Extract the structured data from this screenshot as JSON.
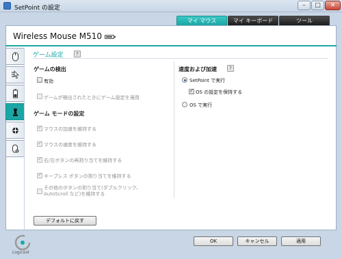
{
  "window": {
    "title": "SetPoint の設定"
  },
  "top_tabs": [
    "マイ マウス",
    "マイ キーボード",
    "ツール"
  ],
  "device": {
    "name": "Wireless Mouse M510",
    "battery_icon": "battery-icon"
  },
  "side_tabs": [
    {
      "icon": "mouse-icon"
    },
    {
      "icon": "pointer-icon"
    },
    {
      "icon": "battery-status-icon"
    },
    {
      "icon": "chess-piece-icon"
    },
    {
      "icon": "settings-icon"
    },
    {
      "icon": "mouse-gear-icon"
    }
  ],
  "section": {
    "title": "ゲーム設定",
    "help": "?"
  },
  "game_detect": {
    "title": "ゲームの検出",
    "enable": {
      "label": "有効",
      "checked": false
    },
    "apply": {
      "label": "ゲームが検出されたときにゲーム設定を適用",
      "checked": false
    }
  },
  "game_mode": {
    "title": "ゲーム モードの設定",
    "items": [
      "マウスの加速を維持する",
      "マウスの速度を維持する",
      "右/左ボタンの再割り当てを維持する",
      "キープレス ボタンの割り当てを維持する",
      "その他のボタンの割り当て(ダブルクリック、AutoScroll など)を維持する"
    ]
  },
  "speed": {
    "title": "速度および加速",
    "help": "?",
    "setpoint_run": "SetPoint で実行",
    "keep_os": "OS の設定を保持する",
    "os_run": "OS で実行"
  },
  "buttons": {
    "defaults": "デフォルトに戻す",
    "ok": "OK",
    "cancel": "キャンセル",
    "apply": "適用"
  },
  "logo": {
    "text": "Logicool"
  },
  "colors": {
    "accent": "#1aa6a4",
    "dark_tab": "#2a2a2a"
  }
}
